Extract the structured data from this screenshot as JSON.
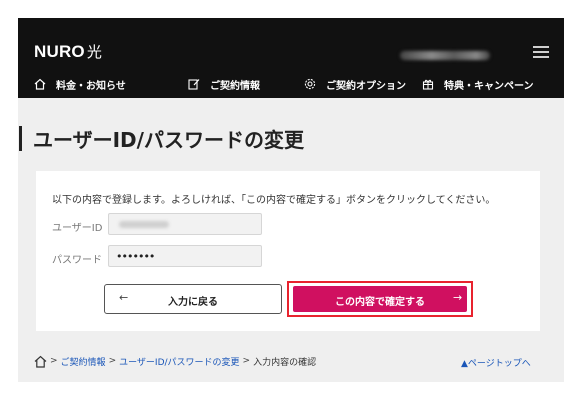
{
  "brand": {
    "logo_text": "NURO",
    "logo_kanji": "光"
  },
  "nav": {
    "items": [
      {
        "label": "料金・お知らせ",
        "icon": "home-icon"
      },
      {
        "label": "ご契約情報",
        "icon": "edit-icon"
      },
      {
        "label": "ご契約オプション",
        "icon": "gear-icon"
      },
      {
        "label": "特典・キャンペーン",
        "icon": "gift-icon"
      }
    ]
  },
  "page": {
    "title": "ユーザーID/パスワードの変更"
  },
  "form": {
    "message": "以下の内容で登録します。よろしければ、「この内容で確定する」ボタンをクリックしてください。",
    "user_id_label": "ユーザーID",
    "password_label": "パスワード",
    "password_mask": "•••••••"
  },
  "buttons": {
    "back_label": "入力に戻る",
    "back_arrow": "←",
    "confirm_label": "この内容で確定する",
    "confirm_arrow": "→"
  },
  "breadcrumb": {
    "sep": ">",
    "items": [
      "ご契約情報",
      "ユーザーID/パスワードの変更",
      "入力内容の確認"
    ]
  },
  "page_top": {
    "label": "▲ページトップへ"
  },
  "colors": {
    "header_bg": "#111111",
    "accent": "#d01060",
    "highlight": "#e8232e",
    "link": "#1a56b8"
  }
}
